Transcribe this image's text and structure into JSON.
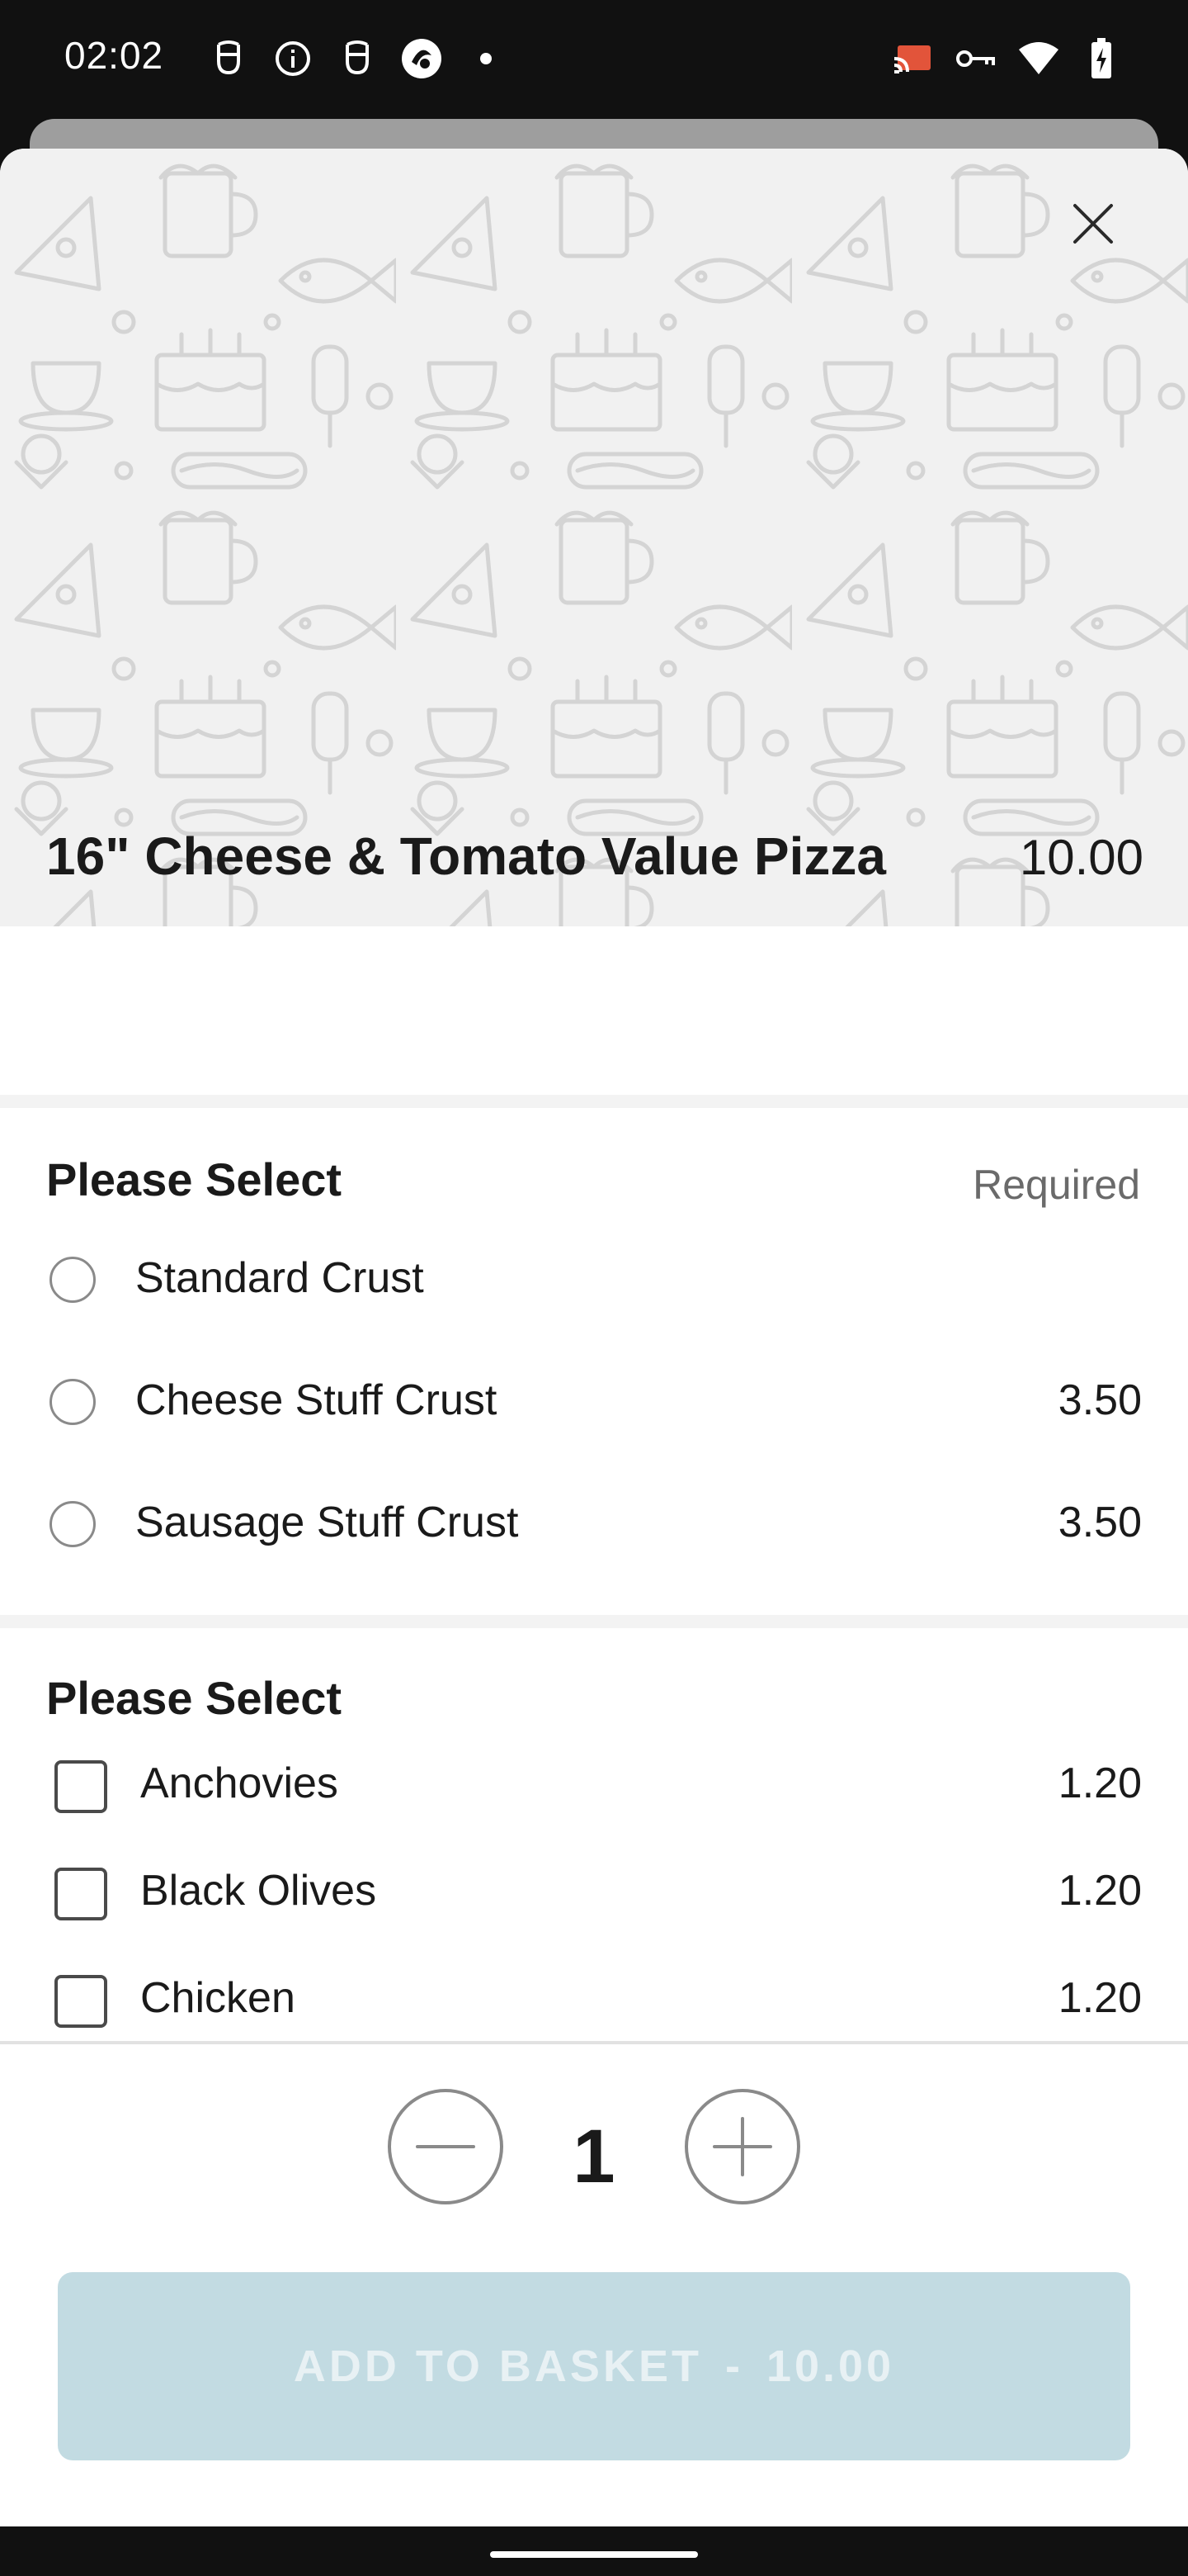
{
  "status_bar": {
    "time": "02:02",
    "left_icons": [
      "hand-icon",
      "info-icon",
      "hand-icon",
      "media-icon"
    ],
    "right_icons": [
      "cast-icon",
      "vpn-key-icon",
      "wifi-icon",
      "battery-charging-icon"
    ]
  },
  "product": {
    "name": "16\" Cheese & Tomato Value Pizza",
    "price": "10.00"
  },
  "crust_section": {
    "title": "Please Select",
    "required_label": "Required",
    "options": [
      {
        "label": "Standard Crust",
        "price": ""
      },
      {
        "label": "Cheese Stuff Crust",
        "price": "3.50"
      },
      {
        "label": "Sausage Stuff Crust",
        "price": "3.50"
      }
    ]
  },
  "toppings_section": {
    "title": "Please Select",
    "options": [
      {
        "label": "Anchovies",
        "price": "1.20"
      },
      {
        "label": "Black Olives",
        "price": "1.20"
      },
      {
        "label": "Chicken",
        "price": "1.20"
      }
    ]
  },
  "quantity": {
    "value": "1"
  },
  "add_button": {
    "label": "ADD TO BASKET",
    "separator": "-",
    "price": "10.00"
  },
  "colors": {
    "add_button_bg": "#c2dbe2",
    "hero_bg": "#f1f1f1"
  }
}
